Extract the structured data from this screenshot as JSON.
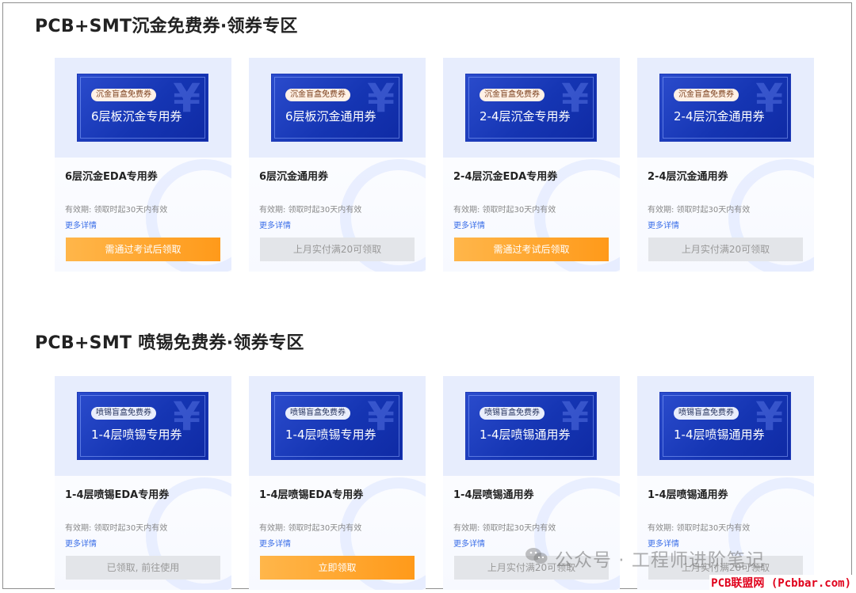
{
  "sections": [
    {
      "title": "PCB+SMT沉金免费券·领券专区",
      "cards": [
        {
          "tag": "沉金盲盒免费券",
          "coupon_title": "6层板沉金专用券",
          "name": "6层沉金EDA专用券",
          "validity": "有效期:  领取时起30天内有效",
          "more": "更多详情",
          "button": "需通过考试后领取",
          "button_style": "orange"
        },
        {
          "tag": "沉金盲盒免费券",
          "coupon_title": "6层板沉金通用券",
          "name": "6层沉金通用券",
          "validity": "有效期:  领取时起30天内有效",
          "more": "更多详情",
          "button": "上月实付满20可领取",
          "button_style": "gray"
        },
        {
          "tag": "沉金盲盒免费券",
          "coupon_title": "2-4层沉金专用券",
          "name": "2-4层沉金EDA专用券",
          "validity": "有效期:  领取时起30天内有效",
          "more": "更多详情",
          "button": "需通过考试后领取",
          "button_style": "orange"
        },
        {
          "tag": "沉金盲盒免费券",
          "coupon_title": "2-4层沉金通用券",
          "name": "2-4层沉金通用券",
          "validity": "有效期:  领取时起30天内有效",
          "more": "更多详情",
          "button": "上月实付满20可领取",
          "button_style": "gray"
        }
      ]
    },
    {
      "title": "PCB+SMT 喷锡免费券·领券专区",
      "cards": [
        {
          "tag": "喷锡盲盒免费券",
          "coupon_title": "1-4层喷锡专用券",
          "name": "1-4层喷锡EDA专用券",
          "validity": "有效期:  领取时起30天内有效",
          "more": "更多详情",
          "button": "已领取, 前往使用",
          "button_style": "gray"
        },
        {
          "tag": "喷锡盲盒免费券",
          "coupon_title": "1-4层喷锡专用券",
          "name": "1-4层喷锡EDA专用券",
          "validity": "有效期:  领取时起30天内有效",
          "more": "更多详情",
          "button": "立即领取",
          "button_style": "orange"
        },
        {
          "tag": "喷锡盲盒免费券",
          "coupon_title": "1-4层喷锡通用券",
          "name": "1-4层喷锡通用券",
          "validity": "有效期:  领取时起30天内有效",
          "more": "更多详情",
          "button": "上月实付满20可领取",
          "button_style": "gray"
        },
        {
          "tag": "喷锡盲盒免费券",
          "coupon_title": "1-4层喷锡通用券",
          "name": "1-4层喷锡通用券",
          "validity": "有效期:  领取时起30天内有效",
          "more": "更多详情",
          "button": "上月实付满20可领取",
          "button_style": "gray"
        }
      ]
    }
  ],
  "coupon_symbol": "¥",
  "watermark": "公众号 · 工程师进阶笔记",
  "site_label": "PCB联盟网 (Pcbbar.com)",
  "colors": {
    "accent_orange": "#ff9a1a",
    "coupon_blue": "#1535b3",
    "link_blue": "#3a6ee8",
    "site_red": "#e0001b"
  },
  "icons": {
    "watermark_icon": "wechat-icon"
  }
}
